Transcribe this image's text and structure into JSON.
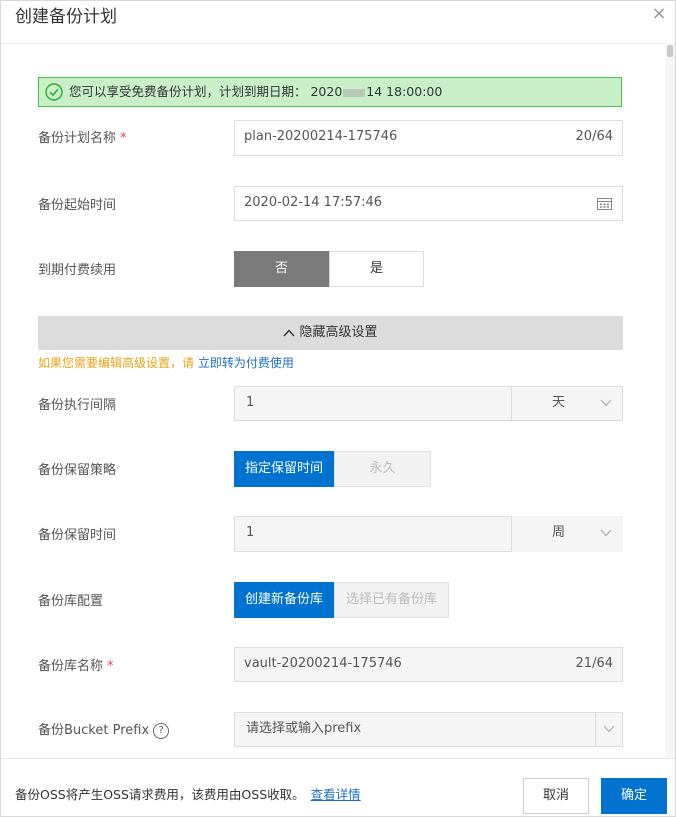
{
  "dialog": {
    "title": "创建备份计划",
    "close": "×"
  },
  "notice": {
    "text_before": "您可以享受免费备份计划，计划到期日期： 2020",
    "text_after": "14 18:00:00"
  },
  "plan_name": {
    "label": "备份计划名称",
    "required": "*",
    "value": "plan-20200214-175746",
    "counter": "20/64"
  },
  "start_time": {
    "label": "备份起始时间",
    "value": "2020-02-14 17:57:46"
  },
  "renew": {
    "label": "到期付费续用",
    "options": [
      "否",
      "是"
    ],
    "selected": "否"
  },
  "advanced": {
    "toggle_label": "隐藏高级设置",
    "note": "如果您需要编辑高级设置，请",
    "note_link": "立即转为付费使用"
  },
  "interval": {
    "label": "备份执行间隔",
    "value": "1",
    "unit": "天"
  },
  "retention_policy": {
    "label": "备份保留策略",
    "options": [
      "指定保留时间",
      "永久"
    ],
    "selected": "指定保留时间"
  },
  "retention_time": {
    "label": "备份保留时间",
    "value": "1",
    "unit": "周"
  },
  "vault_config": {
    "label": "备份库配置",
    "options": [
      "创建新备份库",
      "选择已有备份库"
    ],
    "selected": "创建新备份库"
  },
  "vault_name": {
    "label": "备份库名称",
    "required": "*",
    "value": "vault-20200214-175746",
    "counter": "21/64"
  },
  "bucket_prefix": {
    "label": "备份Bucket Prefix",
    "help": "?",
    "placeholder": "请选择或输入prefix"
  },
  "footer": {
    "text": "备份OSS将产生OSS请求费用，该费用由OSS收取。",
    "link": "查看详情",
    "cancel": "取消",
    "confirm": "确定"
  },
  "colors": {
    "primary": "#0073d0",
    "notice_bg": "#c8efc8",
    "notice_border": "#43c743",
    "warning_text": "#e8a317",
    "required": "#e44444"
  }
}
